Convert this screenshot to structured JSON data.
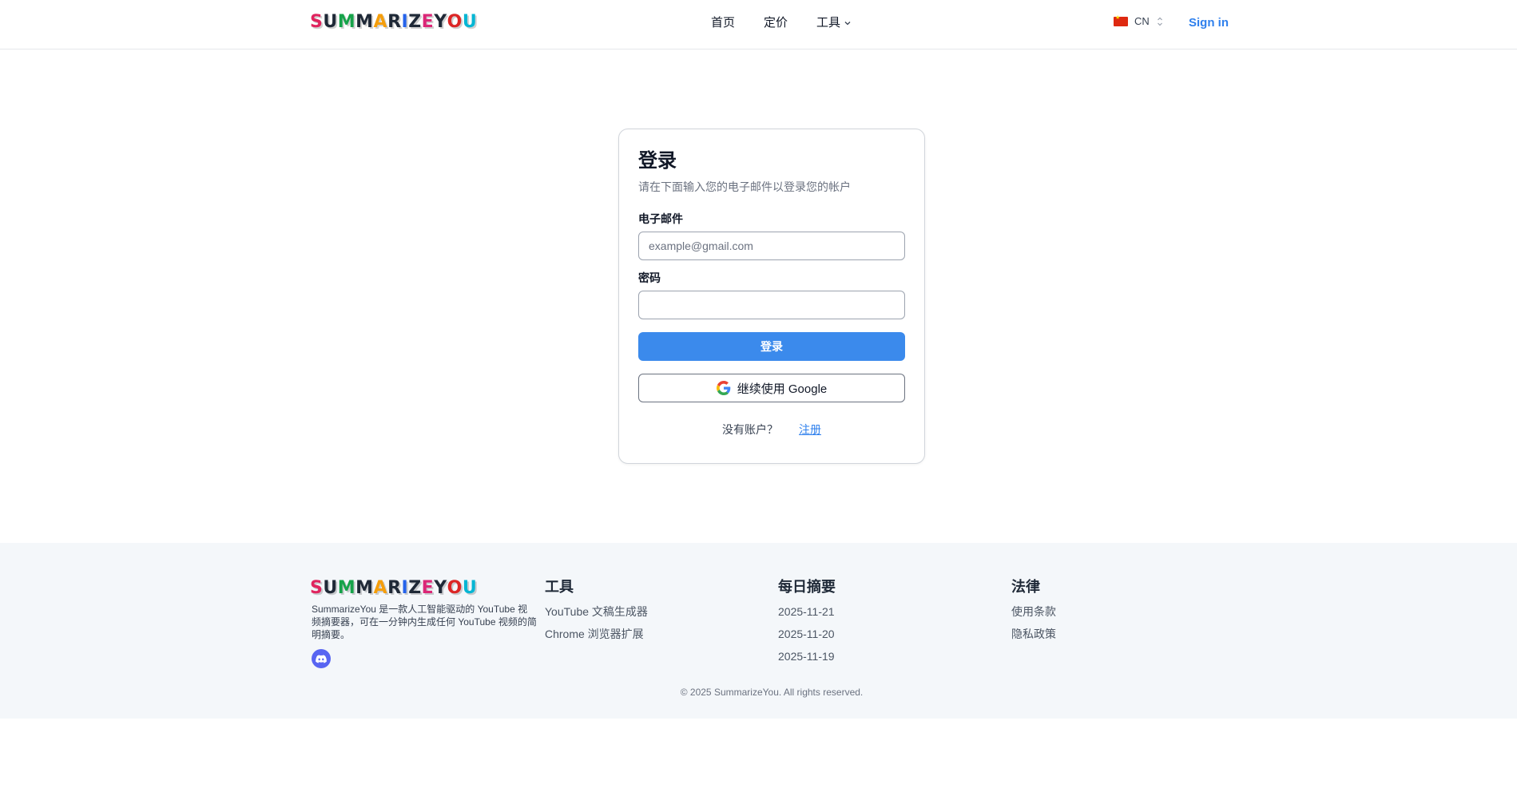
{
  "brand": {
    "logo_letters": [
      "S",
      "U",
      "M",
      "M",
      "A",
      "R",
      "I",
      "Z",
      "E",
      "Y",
      "O",
      "U"
    ],
    "logo_colors": [
      "#1f2937",
      "#1f2937",
      "#1f2937",
      "#1f2937",
      "#1f2937",
      "#1f2937",
      "#1f2937",
      "#1f2937",
      "#1f2937",
      "#1f2937",
      "#1f2937",
      "#1f2937"
    ],
    "accent": "#3b8aec",
    "link": "#2f80ed"
  },
  "header": {
    "nav": [
      {
        "label": "首页"
      },
      {
        "label": "定价"
      },
      {
        "label": "工具",
        "icon": "chevron-down-icon"
      }
    ],
    "language": {
      "code": "CN",
      "flag": "flag-cn-icon"
    },
    "signin_label": "Sign in"
  },
  "login": {
    "title": "登录",
    "subtitle": "请在下面输入您的电子邮件以登录您的帐户",
    "email_label": "电子邮件",
    "email_placeholder": "example@gmail.com",
    "email_value": "",
    "password_label": "密码",
    "password_value": "",
    "submit_label": "登录",
    "google_label": "继续使用 Google",
    "no_account_text": "没有账户？",
    "signup_label": "注册"
  },
  "footer": {
    "description": "SummarizeYou 是一款人工智能驱动的 YouTube 视频摘要器，可在一分钟内生成任何 YouTube 视频的简明摘要。",
    "social_icon": "discord-icon",
    "columns": [
      {
        "title": "工具",
        "links": [
          "YouTube 文稿生成器",
          "Chrome 浏览器扩展"
        ]
      },
      {
        "title": "每日摘要",
        "links": [
          "2025-11-21",
          "2025-11-20",
          "2025-11-19"
        ]
      },
      {
        "title": "法律",
        "links": [
          "使用条款",
          "隐私政策"
        ]
      }
    ],
    "copyright": "© 2025 SummarizeYou. All rights reserved."
  }
}
